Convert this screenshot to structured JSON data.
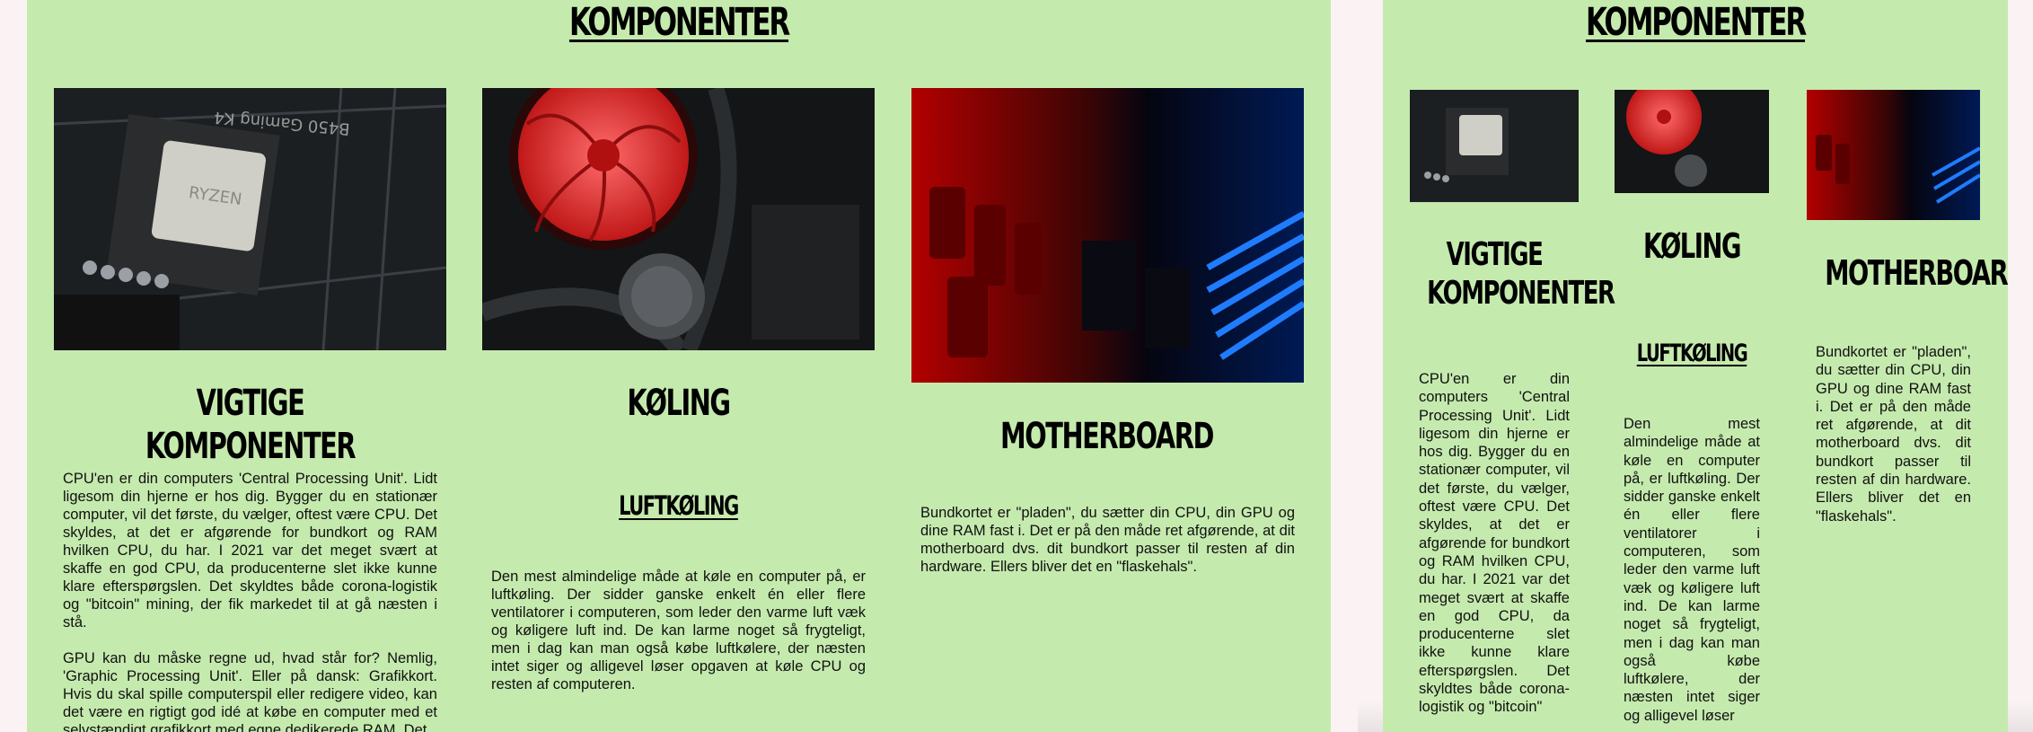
{
  "left": {
    "title": "KOMPONENTER",
    "columns": [
      {
        "heading": "VIGTIGE KOMPONENTER",
        "image": "cpu-photo",
        "chip_label": "RYZEN",
        "board_label": "B450 Gaming K4",
        "paragraphs": [
          "CPU'en er din computers 'Central Processing Unit'. Lidt ligesom din hjerne er hos dig. Bygger du en stationær computer, vil det første, du vælger, oftest være CPU. Det skyldes, at det er afgørende for bundkort og RAM hvilken CPU, du har. I 2021 var det meget svært at skaffe en god CPU, da producenterne slet ikke kunne klare efterspørgslen. Det skyldtes både corona-logistik og \"bitcoin\" mining, der fik markedet til at gå næsten i stå.",
          "GPU kan du måske regne ud, hvad står for? Nemlig, 'Graphic Processing Unit'. Eller på dansk: Grafikkort. Hvis du skal spille computerspil eller redigere video, kan det være en rigtigt god idé at købe en computer med et selvstændigt grafikkort med egne dedikerede RAM. Det"
        ]
      },
      {
        "heading": "KØLING",
        "image": "cooling-photo",
        "subheading": "LUFTKØLING",
        "paragraphs": [
          "Den mest almindelige måde at køle en computer på, er luftkøling. Der sidder ganske enkelt én eller flere ventilatorer i computeren, som leder den varme luft væk og køligere luft ind. De kan larme noget så frygteligt, men i dag kan man også købe luftkølere, der næsten intet siger og alligevel løser opgaven at køle CPU og resten af computeren."
        ]
      },
      {
        "heading": "MOTHERBOARD",
        "image": "motherboard-photo",
        "paragraphs": [
          "Bundkortet er \"pladen\", du sætter din CPU, din GPU og dine RAM fast i. Det er på den måde ret afgørende, at dit motherboard dvs. dit bundkort passer til resten af din hardware. Ellers bliver det en \"flaskehals\"."
        ]
      }
    ]
  },
  "right": {
    "title": "KOMPONENTER",
    "columns": [
      {
        "heading_line1": "VIGTIGE",
        "heading_line2": "KOMPONENTER",
        "text": "CPU'en er din computers 'Central Processing Unit'. Lidt ligesom din hjerne er hos dig. Bygger du en stationær computer, vil det første, du vælger, oftest være CPU. Det skyldes, at det er afgørende for bundkort og RAM hvilken CPU, du har. I 2021 var det meget svært at skaffe en god CPU, da producenterne slet ikke kunne klare efterspørgslen. Det skyldtes både corona-logistik og \"bitcoin\""
      },
      {
        "heading": "KØLING",
        "subheading": "LUFTKØLING",
        "text": "Den mest almindelige måde at køle en computer på, er luftkøling. Der sidder ganske enkelt én eller flere ventilatorer i computeren, som leder den varme luft væk og køligere luft ind. De kan larme noget så frygteligt, men i dag kan man også købe luftkølere, der næsten intet siger og alligevel løser"
      },
      {
        "heading": "MOTHERBOARD",
        "text": "Bundkortet er \"pladen\", du sætter din CPU, din GPU og dine RAM fast i. Det er på den måde ret afgørende, at dit motherboard dvs. dit bundkort passer til resten af din hardware. Ellers bliver det en \"flaskehals\"."
      }
    ]
  },
  "colors": {
    "panel_bg": "#c5eaae",
    "page_bg": "#fbf3f3",
    "text": "#111111"
  }
}
